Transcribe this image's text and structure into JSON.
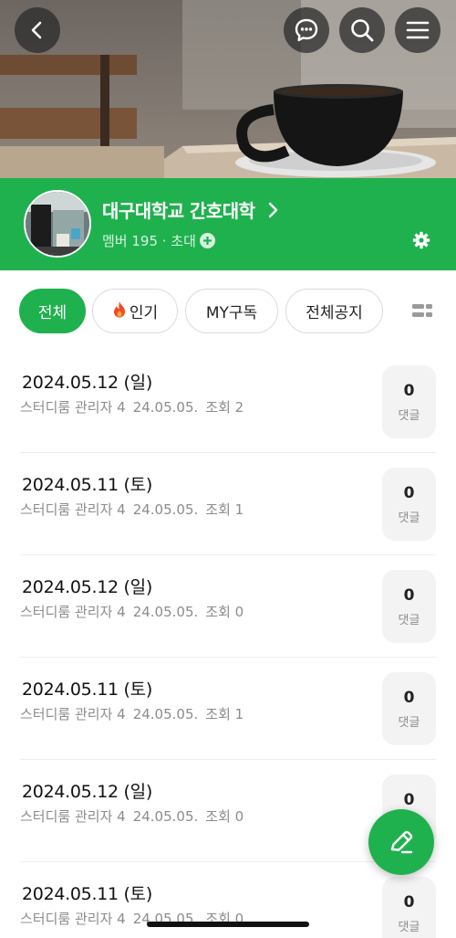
{
  "header": {
    "back_icon": "chevron-left-icon",
    "chat_icon": "chat-bubble-icon",
    "search_icon": "search-icon",
    "menu_icon": "hamburger-menu-icon"
  },
  "cafe": {
    "name": "대구대학교 간호대학",
    "members_text": "멤버 195 · 초대",
    "accent_color": "#1fb14e"
  },
  "tabs": [
    {
      "label": "전체",
      "active": true
    },
    {
      "label": "인기",
      "active": false
    },
    {
      "label": "MY구독",
      "active": false
    },
    {
      "label": "전체공지",
      "active": false
    }
  ],
  "posts": [
    {
      "title": "2024.05.12 (일)",
      "author": "스터디룸 관리자 4",
      "date": "24.05.05.",
      "views": "조회 2",
      "comments": "0",
      "comment_label": "댓글"
    },
    {
      "title": "2024.05.11 (토)",
      "author": "스터디룸 관리자 4",
      "date": "24.05.05.",
      "views": "조회 1",
      "comments": "0",
      "comment_label": "댓글"
    },
    {
      "title": "2024.05.12 (일)",
      "author": "스터디룸 관리자 4",
      "date": "24.05.05.",
      "views": "조회 0",
      "comments": "0",
      "comment_label": "댓글"
    },
    {
      "title": "2024.05.11 (토)",
      "author": "스터디룸 관리자 4",
      "date": "24.05.05.",
      "views": "조회 1",
      "comments": "0",
      "comment_label": "댓글"
    },
    {
      "title": "2024.05.12 (일)",
      "author": "스터디룸 관리자 4",
      "date": "24.05.05.",
      "views": "조회 0",
      "comments": "0",
      "comment_label": "댓글"
    },
    {
      "title": "2024.05.11 (토)",
      "author": "스터디룸 관리자 4",
      "date": "24.05.05.",
      "views": "조회 0",
      "comments": "0",
      "comment_label": "댓글"
    }
  ]
}
